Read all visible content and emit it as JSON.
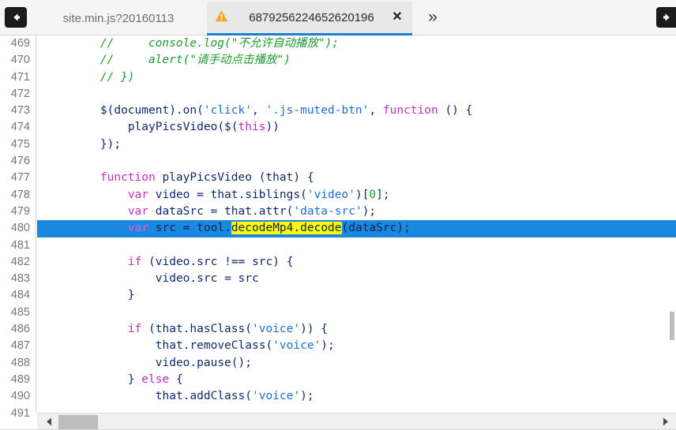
{
  "window": {
    "back_button": "back-arrow",
    "forward_button": "forward-arrow"
  },
  "tabbar": {
    "inactive_tab": {
      "label": "site.min.js?20160113"
    },
    "active_tab": {
      "label": "6879256224652620196",
      "icon": "warning-triangle-icon",
      "close_label": "✕",
      "accent_color": "#1a7fd4"
    },
    "overflow_label": "»"
  },
  "editor": {
    "first_line_number": 469,
    "selected_line_number": 480,
    "search_highlight": "decodeMp4.decode",
    "highlight_color": "#ffff00",
    "selection_color": "#1a87e0",
    "lines": [
      {
        "n": "469",
        "t": "        //     console.log(\"不允许自动播放\");"
      },
      {
        "n": "470",
        "t": "        //     alert(\"请手动点击播放\")"
      },
      {
        "n": "471",
        "t": "        // })"
      },
      {
        "n": "472",
        "t": ""
      },
      {
        "n": "473",
        "t": "        $(document).on('click', '.js-muted-btn', function () {"
      },
      {
        "n": "474",
        "t": "            playPicsVideo($(this))"
      },
      {
        "n": "475",
        "t": "        });"
      },
      {
        "n": "476",
        "t": ""
      },
      {
        "n": "477",
        "t": "        function playPicsVideo (that) {"
      },
      {
        "n": "478",
        "t": "            var video = that.siblings('video')[0];"
      },
      {
        "n": "479",
        "t": "            var dataSrc = that.attr('data-src');"
      },
      {
        "n": "480",
        "t": "            var src = tool.decodeMp4.decode(dataSrc);"
      },
      {
        "n": "481",
        "t": ""
      },
      {
        "n": "482",
        "t": "            if (video.src !== src) {"
      },
      {
        "n": "483",
        "t": "                video.src = src"
      },
      {
        "n": "484",
        "t": "            }"
      },
      {
        "n": "485",
        "t": ""
      },
      {
        "n": "486",
        "t": "            if (that.hasClass('voice')) {"
      },
      {
        "n": "487",
        "t": "                that.removeClass('voice');"
      },
      {
        "n": "488",
        "t": "                video.pause();"
      },
      {
        "n": "489",
        "t": "            } else {"
      },
      {
        "n": "490",
        "t": "                that.addClass('voice');"
      },
      {
        "n": "491",
        "t": ""
      }
    ]
  },
  "scrollbars": {
    "horizontal_left_arrow": "◀",
    "horizontal_right_arrow": "▶"
  }
}
